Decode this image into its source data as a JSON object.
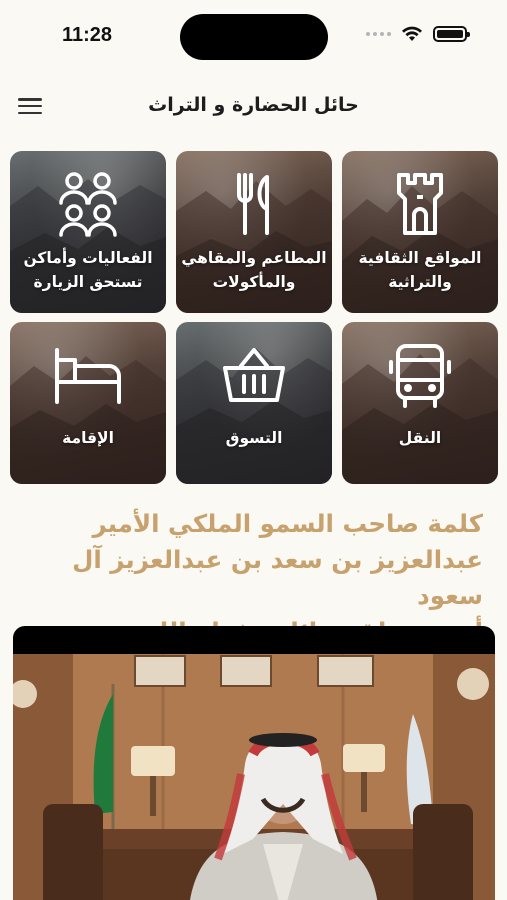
{
  "status_bar": {
    "time": "11:28"
  },
  "header": {
    "title": "حائل الحضارة و التراث"
  },
  "categories": [
    {
      "label": "المواقع الثقافية\nوالتراثية",
      "icon": "castle-tower-icon"
    },
    {
      "label": "المطاعم والمقاهي\nوالمأكولات",
      "icon": "fork-knife-icon"
    },
    {
      "label": "الفعاليات وأماكن\nتستحق الزيارة",
      "icon": "people-group-icon"
    },
    {
      "label": "النقل",
      "icon": "bus-icon"
    },
    {
      "label": "التسوق",
      "icon": "shopping-basket-icon"
    },
    {
      "label": "الإقامة",
      "icon": "bed-icon"
    }
  ],
  "speech": {
    "heading": "كلمة صاحب السمو الملكي الأمير\nعبدالعزيز بن سعد بن عبدالعزيز آل سعود\nأمير منطقة حائل حفظه الله"
  },
  "colors": {
    "accent_gold": "#c7a16e",
    "background": "#fbf9f3"
  }
}
